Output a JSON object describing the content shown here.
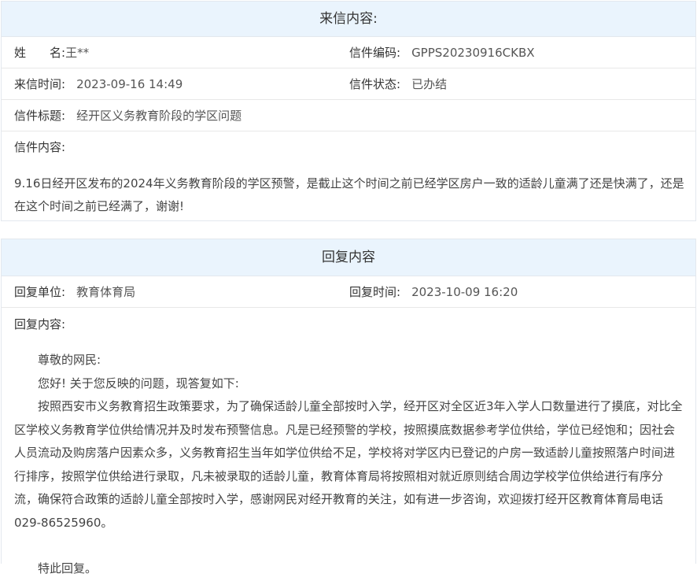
{
  "letter": {
    "header": "来信内容:",
    "name_label_1": "姓",
    "name_label_2": "名:",
    "name_value": "王**",
    "code_label": "信件编码:",
    "code_value": "GPPS20230916CKBX",
    "time_label": "来信时间:",
    "time_value": "2023-09-16 14:49",
    "status_label": "信件状态:",
    "status_value": "已办结",
    "title_label": "信件标题:",
    "title_value": "经开区义务教育阶段的学区问题",
    "content_label": "信件内容:",
    "content_value": "9.16日经开区发布的2024年义务教育阶段的学区预警，是截止这个时间之前已经学区房户一致的适龄儿童满了还是快满了，还是在这个时间之前已经满了，谢谢!"
  },
  "reply": {
    "header": "回复内容",
    "unit_label": "回复单位:",
    "unit_value": "教育体育局",
    "time_label": "回复时间:",
    "time_value": "2023-10-09 16:20",
    "content_label": "回复内容:",
    "greeting": "尊敬的网民:",
    "intro": "您好! 关于您反映的问题，现答复如下:",
    "body": "按照西安市义务教育招生政策要求，为了确保适龄儿童全部按时入学，经开区对全区近3年入学人口数量进行了摸底，对比全区学校义务教育学位供给情况并及时发布预警信息。凡是已经预警的学校，按照摸底数据参考学位供给，学位已经饱和；因社会人员流动及购房落户因素众多，义务教育招生当年如学位供给不足，学校将对学区内已登记的户房一致适龄儿童按照落户时间进行排序，按照学位供给进行录取，凡未被录取的适龄儿童，教育体育局将按照相对就近原则结合周边学校学位供给进行有序分流，确保符合政策的适龄儿童全部按时入学，感谢网民对经开教育的关注，如有进一步咨询，欢迎拨打经开区教育体育局电话029-86525960。",
    "closing": "特此回复。"
  }
}
